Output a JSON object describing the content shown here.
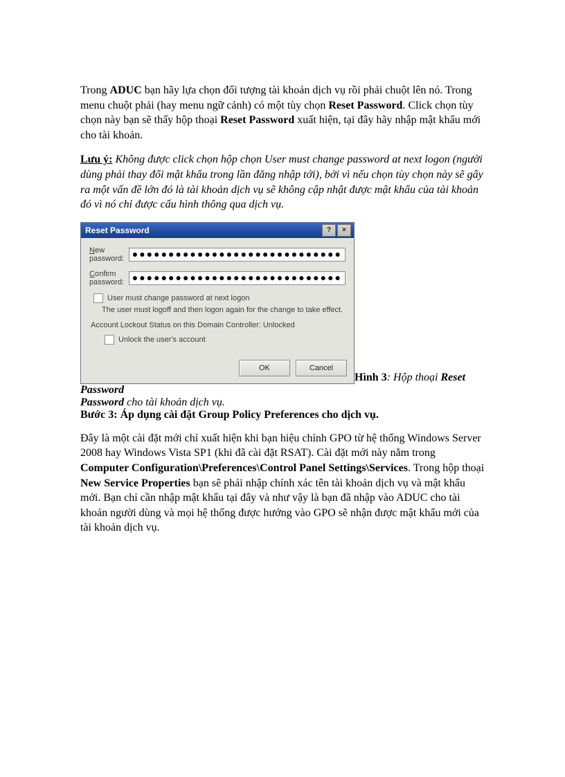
{
  "para1": {
    "t1": "Trong ",
    "aduc": "ADUC",
    "t2": " bạn hãy lựa chọn đối tượng tài khoản dịch vụ rồi phải chuột lên nó. Trong menu chuột phải (hay menu ngữ cảnh) có một tùy chọn ",
    "rp1": "Reset Password",
    "t3": ". Click chọn tùy chọn này bạn sẽ thấy hộp thoại ",
    "rp2": "Reset Password",
    "t4": " xuất hiện, tại đây hãy nhập mật khẩu mới cho tài khoản."
  },
  "note": {
    "label": "Lưu ý:",
    "body": " Không được click chọn hộp chọn User must change password at next logon (người dùng phải thay đổi mật khẩu trong lần đăng nhập tới), bởi vì nếu chọn tùy chọn này sẽ gây ra một vấn đề lớn đó là tài khoản dịch vụ sẽ không cập nhật được mật khẩu của tài khoản đó vì nó chỉ được cấu hình thông qua dịch vụ."
  },
  "dialog": {
    "title": "Reset Password",
    "help_btn": "?",
    "close_btn": "×",
    "new_password_label": {
      "u": "N",
      "rest": "ew password:"
    },
    "confirm_password_label": {
      "u": "C",
      "rest": "onfirm password:"
    },
    "password_value": "●●●●●●●●●●●●●●●●●●●●●●●●●●●●●",
    "checkbox_user_must": {
      "u": "U",
      "rest": "ser must change password at next logon"
    },
    "logoff_text": "The user must logoff and then logon again for the change to take effect.",
    "lockout_text": "Account Lockout Status on this Domain Controller: Unlocked",
    "checkbox_unlock": {
      "pre": "Unlock the user's ",
      "u": "a",
      "rest": "ccount"
    },
    "ok": "OK",
    "cancel": "Cancel"
  },
  "caption": {
    "lead": "Hình 3",
    "mid": ": Hộp thoại ",
    "title": "Reset Password",
    "tail": " cho tài khoản dịch vụ."
  },
  "step3": "Bước 3: Áp dụng cài đặt Group Policy Preferences cho dịch vụ.",
  "para3": {
    "t1": "Đây là một cài đặt mới chỉ xuất hiện khi bạn hiệu chỉnh GPO từ hệ thống Windows Server 2008 hay Windows Vista SP1 (khi đã cài đặt RSAT). Cài đặt mới này nằm trong ",
    "path": "Computer Configuration\\Preferences\\Control Panel Settings\\Services",
    "t2": ". Trong hộp thoại ",
    "nsp": "New Service Properties",
    "t3": " bạn sẽ phải nhập chính xác tên tài khoản dịch vụ và mật khẩu mới. Bạn chỉ cần nhập mật khẩu tại đây và như vậy là bạn đã nhập vào ADUC cho tài khoản người dùng và mọi hệ thống được hướng vào GPO sẽ nhận được mật khẩu mới của tài khoản dịch vụ."
  }
}
